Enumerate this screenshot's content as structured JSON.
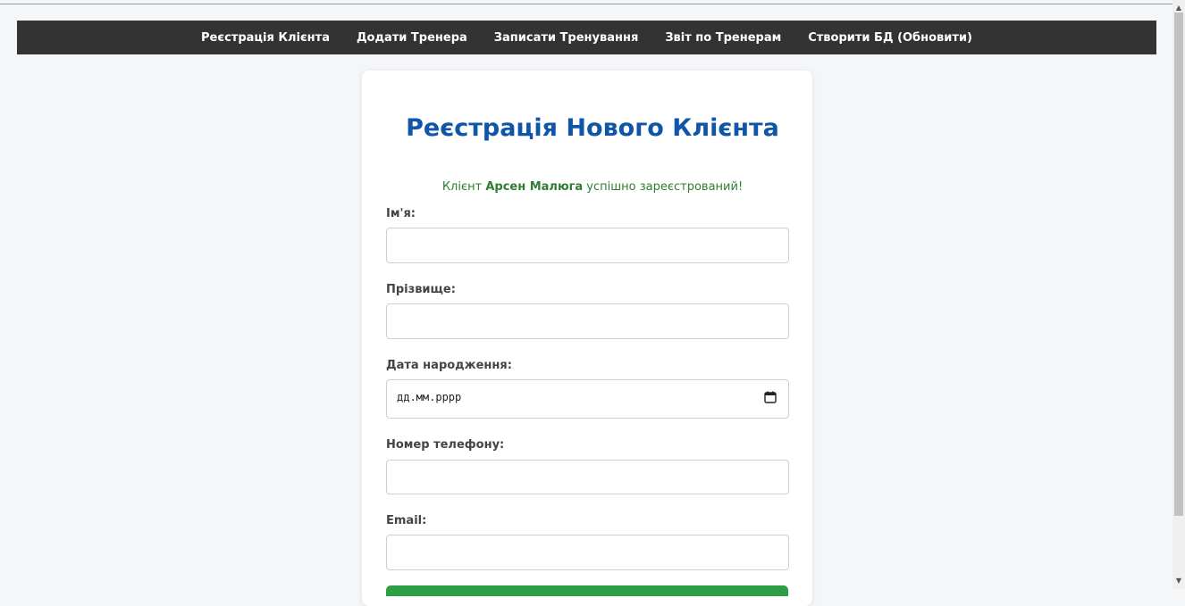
{
  "nav": {
    "items": [
      {
        "label": "Реєстрація Клієнта"
      },
      {
        "label": "Додати Тренера"
      },
      {
        "label": "Записати Тренування"
      },
      {
        "label": "Звіт по Тренерам"
      },
      {
        "label": "Створити БД (Обновити)"
      }
    ]
  },
  "form": {
    "title": "Реєстрація Нового Клієнта",
    "success": {
      "prefix": "Клієнт ",
      "name": "Арсен Малюга",
      "suffix": " успішно зареєстрований!"
    },
    "first_name": {
      "label": "Ім'я:",
      "value": ""
    },
    "last_name": {
      "label": "Прізвище:",
      "value": ""
    },
    "birth_date": {
      "label": "Дата народження:",
      "placeholder": "дд.мм.рррр"
    },
    "phone": {
      "label": "Номер телефону:",
      "value": ""
    },
    "email": {
      "label": "Email:",
      "value": ""
    }
  },
  "colors": {
    "navbar_bg": "#333333",
    "title": "#0f56a8",
    "success": "#2f7d32",
    "submit": "#2e9e45"
  },
  "icons": {
    "date": "calendar-icon",
    "scroll_up": "scroll-up-arrow-icon",
    "scroll_down": "scroll-down-arrow-icon"
  }
}
